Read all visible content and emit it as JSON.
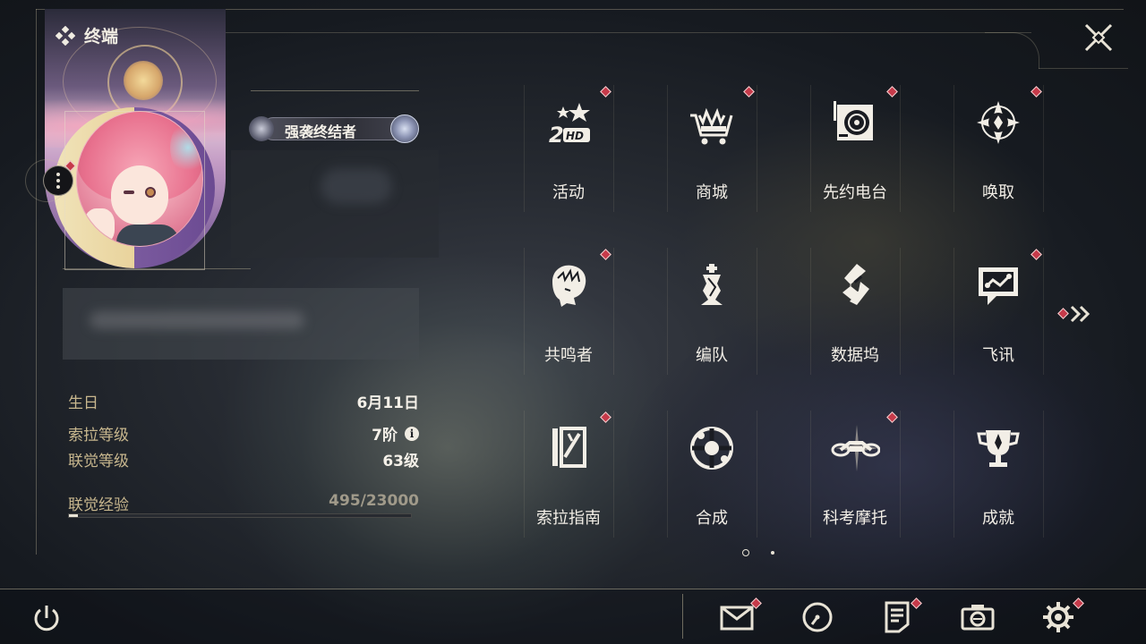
{
  "header": {
    "title": "终端"
  },
  "profile": {
    "title_badge": "强袭终结者",
    "stats": [
      {
        "label": "生日",
        "value": "6月11日"
      },
      {
        "label": "索拉等级",
        "value": "7阶"
      },
      {
        "label": "联觉等级",
        "value": "63级"
      }
    ],
    "exp": {
      "label": "联觉经验",
      "value": "495/23000",
      "current": 495,
      "max": 23000
    }
  },
  "menu": [
    {
      "label": "活动",
      "icon": "event-2hd-icon",
      "badge": true
    },
    {
      "label": "商城",
      "icon": "shop-basket-icon",
      "badge": true
    },
    {
      "label": "先约电台",
      "icon": "radio-station-icon",
      "badge": true
    },
    {
      "label": "唤取",
      "icon": "convene-compass-icon",
      "badge": true
    },
    {
      "label": "共鸣者",
      "icon": "resonator-portrait-icon",
      "badge": true
    },
    {
      "label": "编队",
      "icon": "team-chess-icon",
      "badge": false
    },
    {
      "label": "数据坞",
      "icon": "data-bank-icon",
      "badge": false
    },
    {
      "label": "飞讯",
      "icon": "chat-message-icon",
      "badge": true
    },
    {
      "label": "索拉指南",
      "icon": "sol-guide-book-icon",
      "badge": true
    },
    {
      "label": "合成",
      "icon": "synthesis-orb-icon",
      "badge": false
    },
    {
      "label": "科考摩托",
      "icon": "motorbike-icon",
      "badge": true
    },
    {
      "label": "成就",
      "icon": "trophy-icon",
      "badge": false
    }
  ],
  "pagination": {
    "current": 1,
    "total": 2
  },
  "bottom_bar": [
    {
      "name": "mail-icon",
      "badge": true
    },
    {
      "name": "clock-icon",
      "badge": false
    },
    {
      "name": "notice-icon",
      "badge": true
    },
    {
      "name": "camera-icon",
      "badge": false
    },
    {
      "name": "settings-gear-icon",
      "badge": true
    }
  ],
  "colors": {
    "accent_red": "#c63a4a",
    "label_gold": "#c8b78e",
    "text_light": "#f2eee6"
  }
}
